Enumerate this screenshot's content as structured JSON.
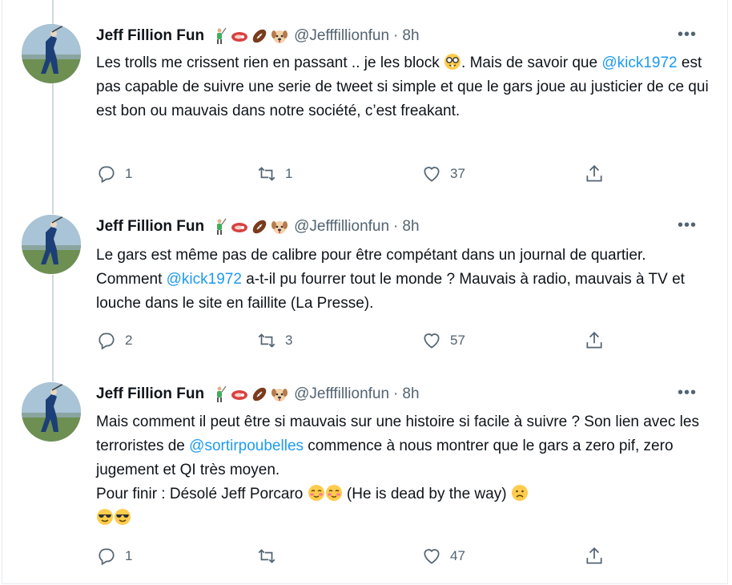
{
  "tweets": [
    {
      "name": "Jeff Fillion Fun",
      "handle": "@Jefffillionfun",
      "time": "8h",
      "header_emojis": [
        "golfer-emoji",
        "steak-emoji",
        "football-emoji",
        "dog-face-emoji"
      ],
      "text_parts": [
        "Les trolls me crissent rien en passant .. je les block ",
        "[nerd-face-emoji]",
        ". Mais de savoir que ",
        "@kick1972",
        " est pas capable de suivre une serie de tweet si simple et que le gars joue au justicier de ce qui est bon ou mauvais dans notre société, c’est freakant."
      ],
      "replies": "1",
      "retweets": "1",
      "likes": "37"
    },
    {
      "name": "Jeff Fillion Fun",
      "handle": "@Jefffillionfun",
      "time": "8h",
      "header_emojis": [
        "golfer-emoji",
        "steak-emoji",
        "football-emoji",
        "dog-face-emoji"
      ],
      "text_parts": [
        "Le gars est même pas de calibre pour être compétant dans un journal de quartier. Comment ",
        "@kick1972",
        " a-t-il pu fourrer tout le monde ? Mauvais à radio, mauvais à TV et louche dans le site en faillite (La Presse)."
      ],
      "replies": "2",
      "retweets": "3",
      "likes": "57"
    },
    {
      "name": "Jeff Fillion Fun",
      "handle": "@Jefffillionfun",
      "time": "8h",
      "header_emojis": [
        "golfer-emoji",
        "steak-emoji",
        "football-emoji",
        "dog-face-emoji"
      ],
      "text_parts": [
        "Mais comment il peut être si mauvais sur une histoire si facile à suivre ? Son lien avec les terroristes de ",
        "@sortirpoubelles",
        " commence à nous montrer que le gars a zero pif, zero jugement et QI très moyen.\nPour finir : Désolé Jeff Porcaro ",
        "[blushing-emoji]",
        "[blushing-emoji]",
        " (He is dead by the way) ",
        "[frowning-emoji]",
        "\n",
        "[sunglasses-emoji]",
        "[sunglasses-emoji]"
      ],
      "replies": "1",
      "retweets": "",
      "likes": "47"
    }
  ],
  "colors": {
    "text": "#0f1419",
    "secondary": "#536471",
    "link": "#1d9bf0",
    "border": "#e6ecf0",
    "thread_line": "#cfd9de"
  },
  "icons": {
    "reply": "reply-icon",
    "retweet": "retweet-icon",
    "like": "like-icon",
    "share": "share-icon",
    "more": "more-icon"
  }
}
